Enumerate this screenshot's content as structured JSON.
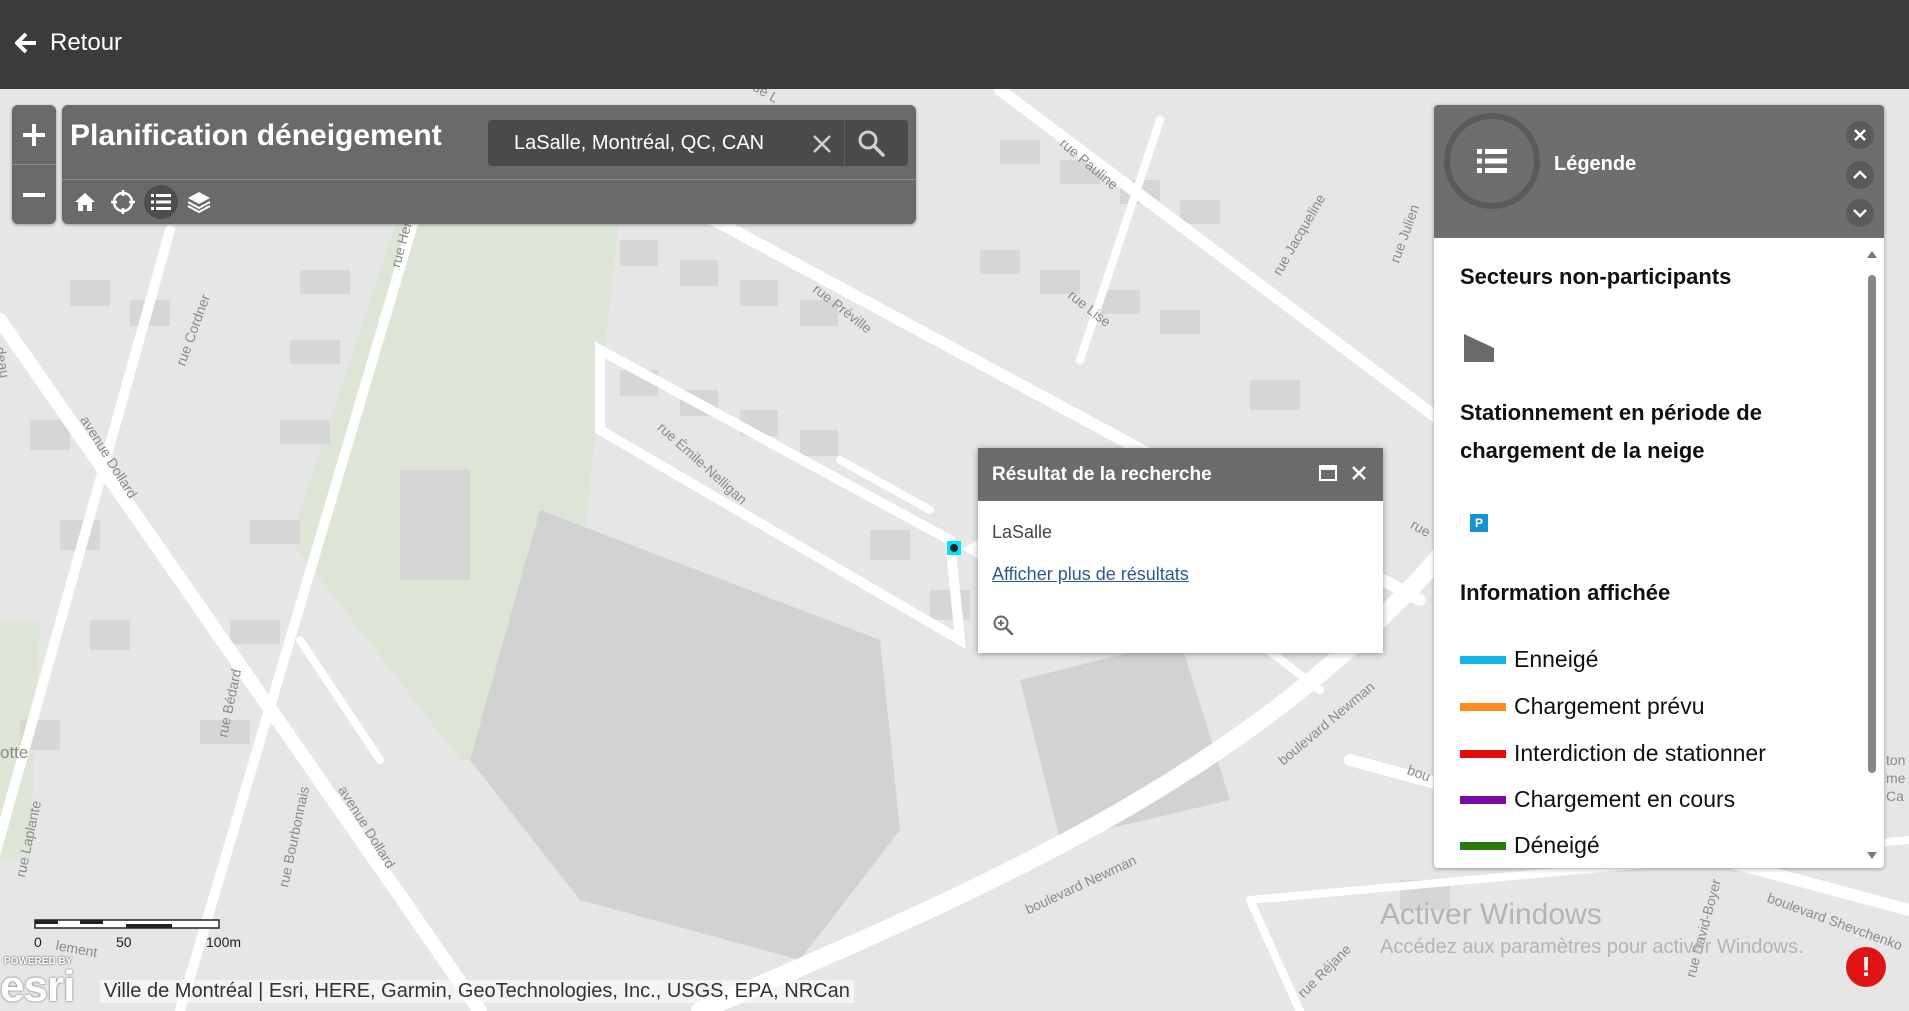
{
  "topbar": {
    "back_label": "Retour"
  },
  "app": {
    "title": "Planification déneigement"
  },
  "search": {
    "value": "LaSalle, Montréal, QC, CAN"
  },
  "map": {
    "streets": [
      "rue Pauline",
      "rue Jacqueline",
      "rue Préville",
      "rue Lise",
      "rue Julien",
      "rue Émile-Nelligan",
      "rue Cordner",
      "avenue Dollard",
      "avenue Dollard",
      "rue Bédard",
      "rue Laplante",
      "rue Bourbonnais",
      "boulevard Newman",
      "boulevard Newman",
      "boulevard Shevchenko",
      "rue Réjane",
      "rue David-Boyer",
      "rue Henry"
    ],
    "edge_fragments": [
      "rue L",
      "rue",
      "deau",
      "otte",
      "lement",
      "bou",
      "ton me Ca"
    ]
  },
  "scale": {
    "labels": [
      "0",
      "50",
      "100m"
    ]
  },
  "attribution": {
    "logo_text": "esri",
    "logo_subtext": "POWERED BY",
    "text": "Ville de Montréal | Esri, HERE, Garmin, GeoTechnologies, Inc., USGS, EPA, NRCan"
  },
  "popup": {
    "title": "Résultat de la recherche",
    "result": "LaSalle",
    "more_link": "Afficher plus de résultats"
  },
  "legend": {
    "title": "Légende",
    "sections": [
      {
        "title": "Secteurs non-participants"
      },
      {
        "title": "Stationnement en période de chargement de la neige",
        "symbol_text": "P"
      },
      {
        "title": "Information affichée"
      }
    ],
    "items": [
      {
        "label": "Enneigé",
        "color": "#12b6ea"
      },
      {
        "label": "Chargement prévu",
        "color": "#ff8b1f"
      },
      {
        "label": "Interdiction de stationner",
        "color": "#e20e0e"
      },
      {
        "label": "Chargement en cours",
        "color": "#7a0ea8"
      },
      {
        "label": "Déneigé",
        "color": "#2a7a12"
      }
    ]
  },
  "watermark": {
    "line1": "Activer Windows",
    "line2": "Accédez aux paramètres pour activer Windows."
  },
  "alert": {
    "symbol": "!"
  },
  "icons": [
    "arrow-left-icon",
    "plus-icon",
    "minus-icon",
    "home-icon",
    "locate-icon",
    "list-icon",
    "layers-icon",
    "search-icon",
    "close-icon",
    "maximize-icon",
    "chevron-up-icon",
    "chevron-down-icon",
    "zoom-to-icon",
    "alert-icon"
  ]
}
